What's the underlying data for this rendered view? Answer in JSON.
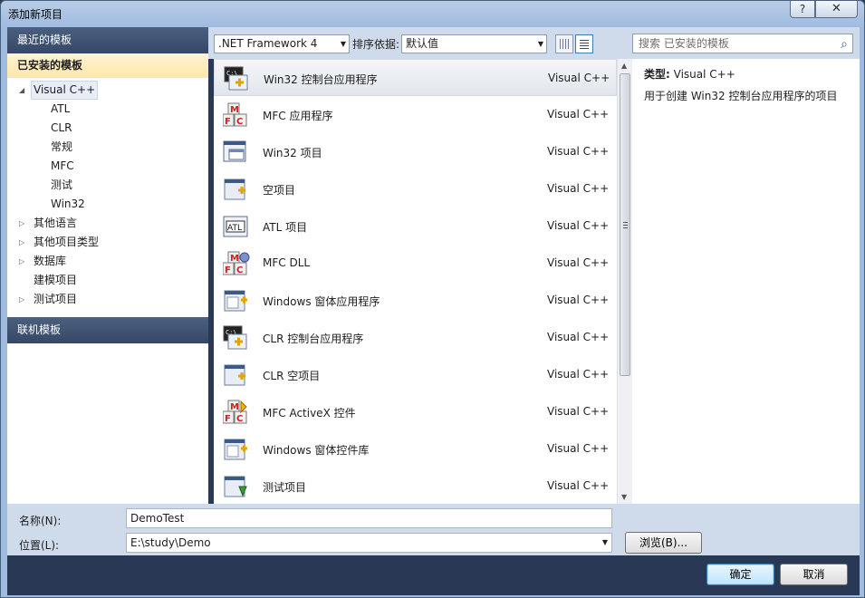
{
  "window": {
    "title": "添加新项目",
    "help": "?",
    "close": "✕"
  },
  "nav": {
    "recent": "最近的模板",
    "installed": "已安装的模板",
    "tree": [
      {
        "label": "Visual C++",
        "level": 0,
        "arrow": "◢",
        "selected": true
      },
      {
        "label": "ATL",
        "level": 1
      },
      {
        "label": "CLR",
        "level": 1
      },
      {
        "label": "常规",
        "level": 1
      },
      {
        "label": "MFC",
        "level": 1
      },
      {
        "label": "测试",
        "level": 1
      },
      {
        "label": "Win32",
        "level": 1
      },
      {
        "label": "其他语言",
        "level": 0,
        "arrow": "▷"
      },
      {
        "label": "其他项目类型",
        "level": 0,
        "arrow": "▷"
      },
      {
        "label": "数据库",
        "level": 0,
        "arrow": "▷"
      },
      {
        "label": "建模项目",
        "level": 0
      },
      {
        "label": "测试项目",
        "level": 0,
        "arrow": "▷"
      }
    ],
    "online": "联机模板"
  },
  "toolbar": {
    "framework": ".NET Framework 4",
    "sort_label": "排序依据:",
    "sort_value": "默认值",
    "search_placeholder": "搜索 已安装的模板",
    "search_icon": "search-icon"
  },
  "templates": [
    {
      "name": "Win32 控制台应用程序",
      "lang": "Visual C++",
      "icon": "console",
      "selected": true
    },
    {
      "name": "MFC 应用程序",
      "lang": "Visual C++",
      "icon": "mfc"
    },
    {
      "name": "Win32 项目",
      "lang": "Visual C++",
      "icon": "window"
    },
    {
      "name": "空项目",
      "lang": "Visual C++",
      "icon": "empty"
    },
    {
      "name": "ATL 项目",
      "lang": "Visual C++",
      "icon": "atl"
    },
    {
      "name": "MFC DLL",
      "lang": "Visual C++",
      "icon": "mfc-dll"
    },
    {
      "name": "Windows 窗体应用程序",
      "lang": "Visual C++",
      "icon": "forms"
    },
    {
      "name": "CLR 控制台应用程序",
      "lang": "Visual C++",
      "icon": "console"
    },
    {
      "name": "CLR 空项目",
      "lang": "Visual C++",
      "icon": "empty"
    },
    {
      "name": "MFC ActiveX 控件",
      "lang": "Visual C++",
      "icon": "mfc-activex"
    },
    {
      "name": "Windows 窗体控件库",
      "lang": "Visual C++",
      "icon": "forms-lib"
    },
    {
      "name": "测试项目",
      "lang": "Visual C++",
      "icon": "test"
    }
  ],
  "details": {
    "type_label": "类型:",
    "type_value": "Visual C++",
    "description": "用于创建 Win32 控制台应用程序的项目"
  },
  "form": {
    "name_label": "名称(N):",
    "name_value": "DemoTest",
    "location_label": "位置(L):",
    "location_value": "E:\\study\\Demo",
    "browse": "浏览(B)..."
  },
  "buttons": {
    "ok": "确定",
    "cancel": "取消"
  }
}
